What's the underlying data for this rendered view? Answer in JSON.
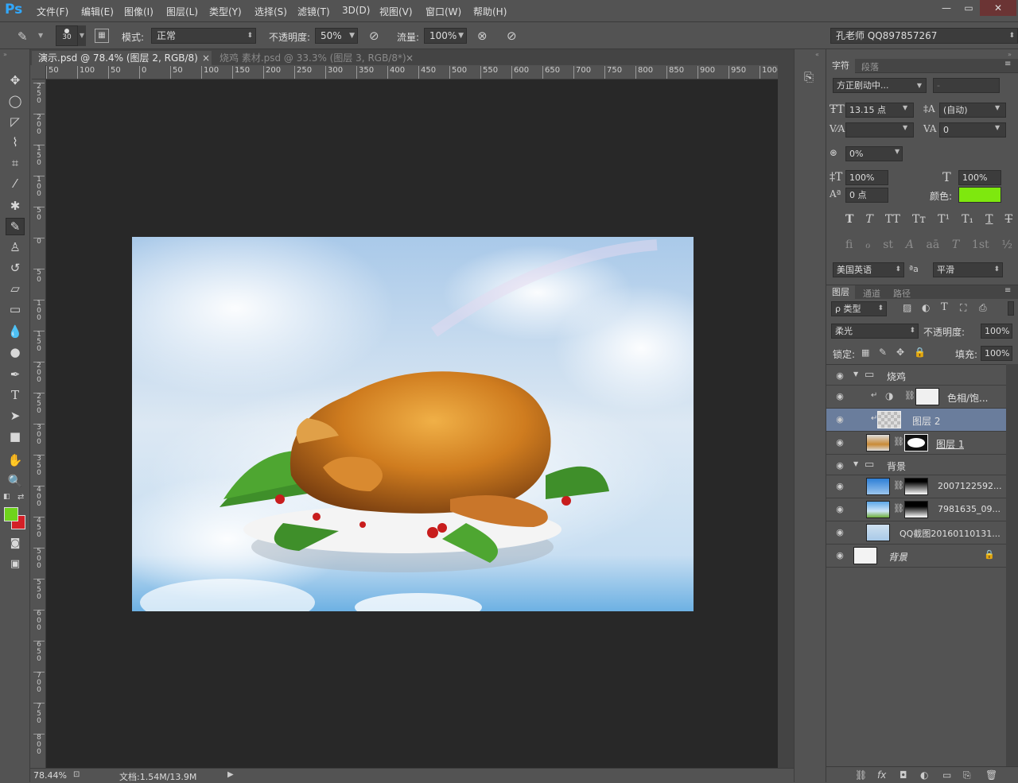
{
  "app": {
    "logo": "Ps"
  },
  "menu": [
    "文件(F)",
    "编辑(E)",
    "图像(I)",
    "图层(L)",
    "类型(Y)",
    "选择(S)",
    "滤镜(T)",
    "3D(D)",
    "视图(V)",
    "窗口(W)",
    "帮助(H)"
  ],
  "window_controls": {
    "minimize": "—",
    "restore": "▭",
    "close": "✕"
  },
  "options": {
    "brush_size": "30",
    "mode_label": "模式:",
    "mode_value": "正常",
    "opacity_label": "不透明度:",
    "opacity_value": "50%",
    "flow_label": "流量:",
    "flow_value": "100%",
    "workspace": "孔老师 QQ897857267"
  },
  "tabs": [
    {
      "label": "演示.psd @ 78.4% (图层 2, RGB/8) *",
      "close": "×"
    },
    {
      "label": "烧鸡 素材.psd @ 33.3% (图层 3, RGB/8*) *",
      "close": "×"
    }
  ],
  "ruler_h": [
    "50",
    "100",
    "50",
    "0",
    "50",
    "100",
    "150",
    "200",
    "250",
    "300",
    "350",
    "400",
    "450",
    "500",
    "550",
    "600",
    "650",
    "700",
    "750",
    "800",
    "850",
    "900",
    "950",
    "1000"
  ],
  "ruler_v": [
    "2\n5\n0",
    "2\n0\n0",
    "1\n5\n0",
    "1\n0\n0",
    "5\n0",
    "0",
    "5\n0",
    "1\n0\n0",
    "1\n5\n0",
    "2\n0\n0",
    "2\n5\n0",
    "3\n0\n0",
    "3\n5\n0",
    "4\n0\n0",
    "4\n5\n0",
    "5\n0\n0",
    "5\n5\n0",
    "6\n0\n0",
    "6\n5\n0",
    "7\n0\n0",
    "7\n5\n0",
    "8\n0\n0"
  ],
  "status": {
    "zoom": "78.44%",
    "doc": "文档:1.54M/13.9M"
  },
  "colors": {
    "foreground": "#6fd41c",
    "background": "#d42027",
    "text_color": "#7ee80e",
    "selected_layer": "#6a7d9c"
  },
  "character": {
    "tabs": [
      "字符",
      "段落"
    ],
    "font_family": "方正剧动中...",
    "font_style": "-",
    "font_size": "13.15 点",
    "leading": "(自动)",
    "kerning": "",
    "tracking": "0",
    "scale_pct": "0%",
    "vscale": "100%",
    "hscale": "100%",
    "baseline": "0 点",
    "color_label": "颜色:",
    "style_buttons": [
      "T",
      "T",
      "TT",
      "Tт",
      "T¹",
      "T₁",
      "T",
      "T"
    ],
    "ot_buttons": [
      "fi",
      "ℴ",
      "st",
      "A",
      "aā",
      "T",
      "1st",
      "½"
    ],
    "language": "美国英语",
    "aa_icon": "ªa",
    "antialias": "平滑"
  },
  "layers_panel": {
    "tabs": [
      "图层",
      "通道",
      "路径"
    ],
    "filter": "ρ 类型",
    "blend_mode": "柔光",
    "opacity_label": "不透明度:",
    "opacity": "100%",
    "lock_label": "锁定:",
    "fill_label": "填充:",
    "fill": "100%",
    "layers": [
      {
        "name": "烧鸡",
        "type": "group"
      },
      {
        "name": "色相/饱...",
        "type": "adjustment"
      },
      {
        "name": "图层 2",
        "type": "layer",
        "selected": true
      },
      {
        "name": "图层 1",
        "type": "layer"
      },
      {
        "name": "背景",
        "type": "group"
      },
      {
        "name": "2007122592...",
        "type": "layer"
      },
      {
        "name": "7981635_09...",
        "type": "layer"
      },
      {
        "name": "QQ截图20160110131...",
        "type": "layer"
      },
      {
        "name": "背景",
        "type": "background"
      }
    ],
    "footer_icons": [
      "link-icon",
      "fx-icon",
      "mask-icon",
      "adjustment-icon",
      "folder-icon",
      "new-layer-icon",
      "trash-icon"
    ]
  }
}
